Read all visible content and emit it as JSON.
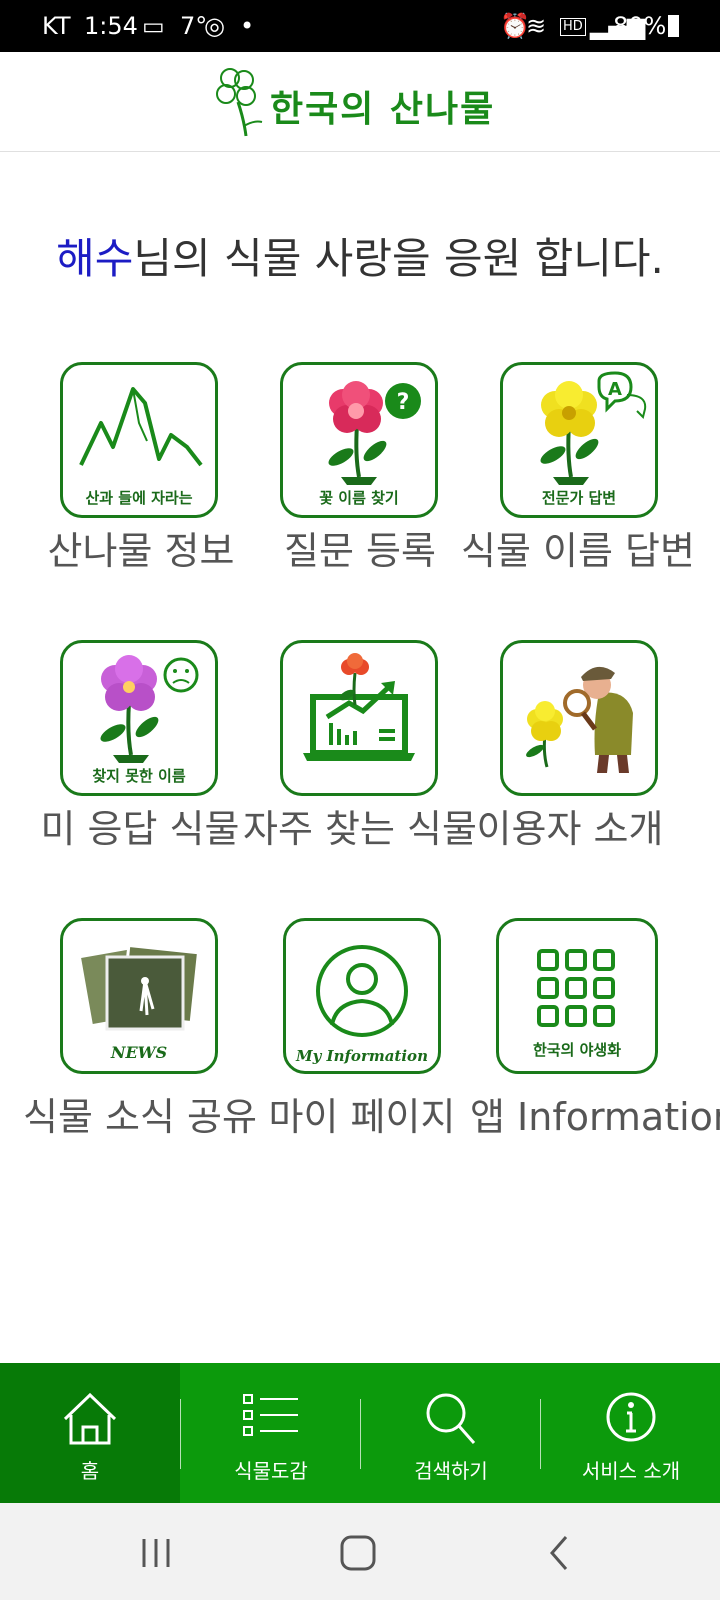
{
  "status_bar": {
    "carrier": "KT",
    "time": "1:54",
    "temperature": "7°",
    "battery": "80%"
  },
  "header": {
    "app_title": "한국의 산나물"
  },
  "welcome": {
    "user_name": "해수",
    "message": "님의 식물 사랑을 응원 합니다."
  },
  "tiles": [
    {
      "caption": "산과 들에 자라는",
      "label": "산나물 정보"
    },
    {
      "caption": "꽃 이름 찾기",
      "label": "질문 등록"
    },
    {
      "caption": "전문가 답변",
      "label": "식물 이름 답변"
    },
    {
      "caption": "찾지 못한 이름",
      "label": "미 응답 식물"
    },
    {
      "caption": "",
      "label": "자주 찾는 식물"
    },
    {
      "caption": "",
      "label": "이용자 소개"
    },
    {
      "caption": "NEWS",
      "label": "식물 소식 공유"
    },
    {
      "caption": "My Information",
      "label": "마이 페이지"
    },
    {
      "caption": "한국의 야생화",
      "label": "앱 Information"
    }
  ],
  "bottom_nav": [
    {
      "label": "홈",
      "icon": "home-icon",
      "active": true
    },
    {
      "label": "식물도감",
      "icon": "list-icon"
    },
    {
      "label": "검색하기",
      "icon": "search-icon"
    },
    {
      "label": "서비스 소개",
      "icon": "info-icon"
    }
  ],
  "colors": {
    "brand_green": "#0c9a0c",
    "active_green": "#077a07",
    "tile_border": "#1a7a1a",
    "user_name": "#1c1cc4"
  }
}
